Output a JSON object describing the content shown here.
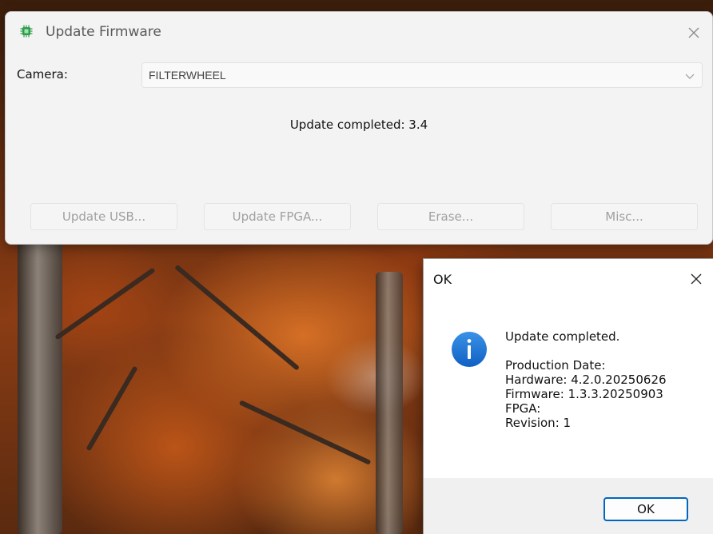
{
  "main_window": {
    "title": "Update Firmware",
    "icon": "chip-icon",
    "camera_label": "Camera:",
    "camera_value": "FILTERWHEEL",
    "status": "Update completed: 3.4",
    "buttons": [
      {
        "label": "Update USB...",
        "enabled": false
      },
      {
        "label": "Update FPGA...",
        "enabled": false
      },
      {
        "label": "Erase...",
        "enabled": false
      },
      {
        "label": "Misc...",
        "enabled": false
      }
    ]
  },
  "dialog": {
    "title": "OK",
    "icon": "info-icon",
    "heading": "Update completed.",
    "details": [
      "Production Date:",
      "Hardware: 4.2.0.20250626",
      "Firmware: 1.3.3.20250903",
      "FPGA:",
      "Revision: 1"
    ],
    "ok_label": "OK"
  },
  "colors": {
    "accent": "#0067c0",
    "info_icon": "#1c73d2",
    "app_icon": "#2e9e4a"
  }
}
